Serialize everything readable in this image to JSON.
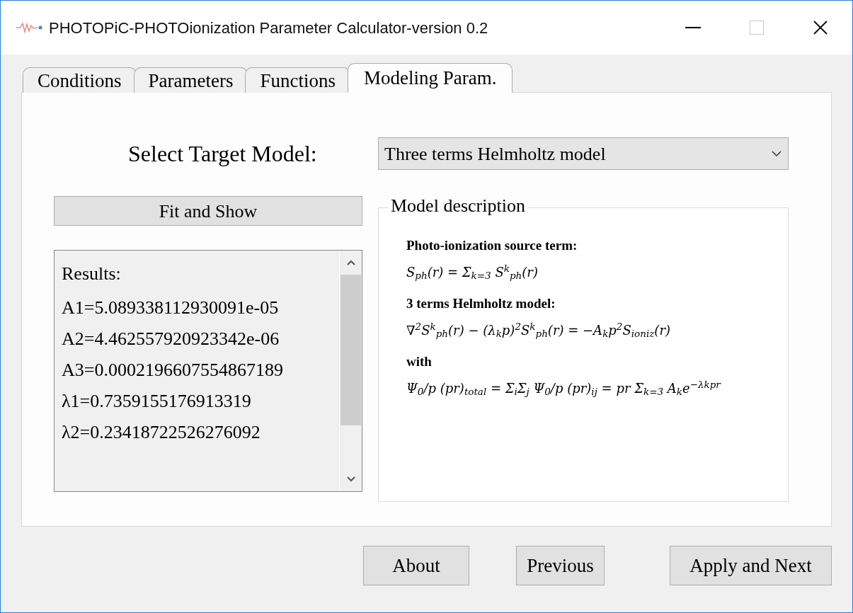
{
  "window": {
    "title": "PHOTOPiC-PHOTOionization Parameter Calculator-version 0.2"
  },
  "tabs": [
    {
      "label": "Conditions",
      "selected": false
    },
    {
      "label": "Parameters",
      "selected": false
    },
    {
      "label": "Functions",
      "selected": false
    },
    {
      "label": "Modeling Param.",
      "selected": true
    }
  ],
  "target_model": {
    "label": "Select Target Model:",
    "value": "Three terms Helmholtz model"
  },
  "fit_button": "Fit and Show",
  "results": [
    "Results:",
    "A1=5.089338112930091e-05",
    "A2=4.462557920923342e-06",
    "A3=0.0002196607554867189",
    "λ1=0.7359155176913319",
    "λ2=0.23418722526276092"
  ],
  "model_description": {
    "title": "Model description",
    "items": [
      {
        "kind": "heading",
        "text": "Photo-ionization source term:"
      },
      {
        "kind": "formula",
        "text": "S$_{ph}$(r) = Σ$_{k=3}$ S$^{k}$$_{ph}$(r)"
      },
      {
        "kind": "heading",
        "text": "3 terms Helmholtz model:"
      },
      {
        "kind": "formula",
        "text": "∇$^{2}$S$^{k}$$_{ph}$(r) − (λ$_{k}$p)$^{2}$S$^{k}$$_{ph}$(r) = −A$_{k}$p$^{2}$S$_{ioniz}$(r)"
      },
      {
        "kind": "heading",
        "text": "with"
      },
      {
        "kind": "formula",
        "text": "Ψ$_{0}$/p (pr)$_{total}$ = Σ$_{i}$Σ$_{j}$ Ψ$_{0}$/p (pr)$_{ij}$ = pr Σ$_{k=3}$ A$_{k}$e$^{−λkpr}$"
      }
    ]
  },
  "buttons": [
    "About",
    "Previous",
    "Apply and Next"
  ]
}
